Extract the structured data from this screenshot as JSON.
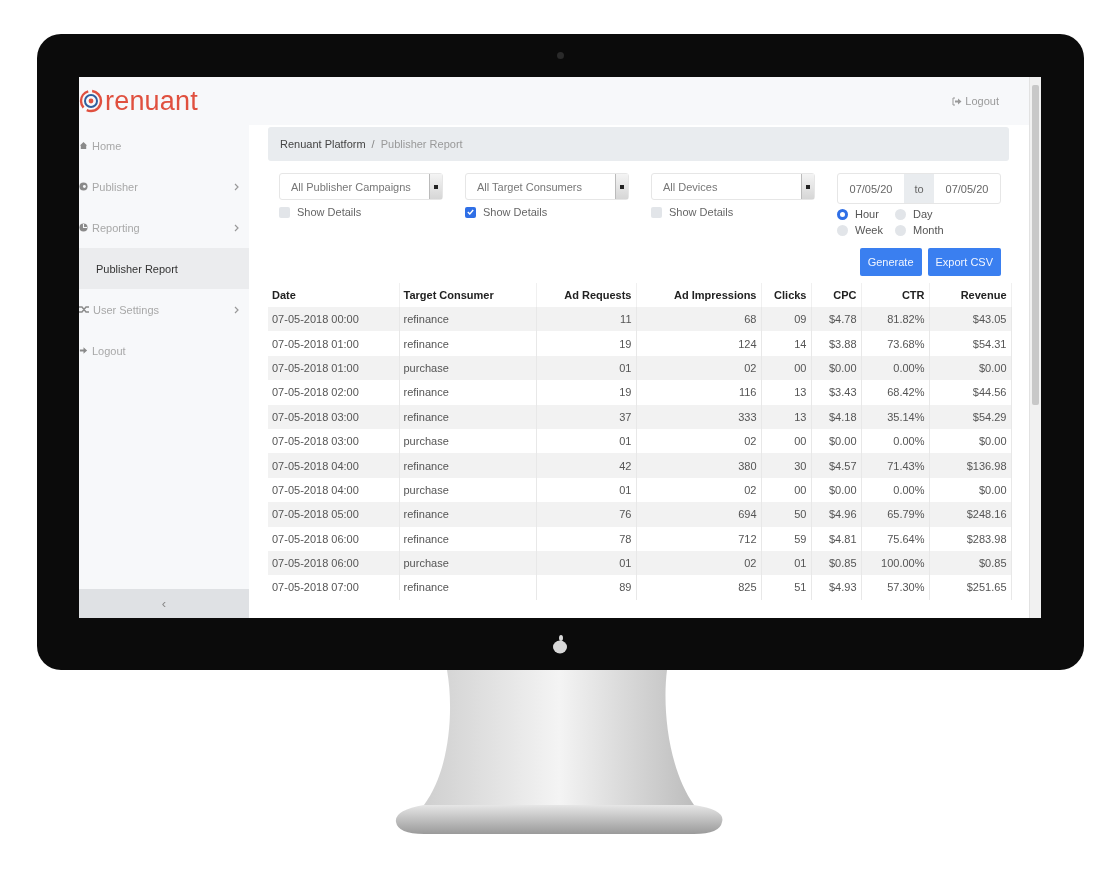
{
  "logo": {
    "text": "renuant"
  },
  "header": {
    "logout": "Logout"
  },
  "sidebar": {
    "items": [
      {
        "label": "Home",
        "kind": "home",
        "submenu": false,
        "selected": false
      },
      {
        "label": "Publisher",
        "kind": "publisher",
        "submenu": true,
        "selected": false
      },
      {
        "label": "Reporting",
        "kind": "reporting",
        "submenu": true,
        "selected": false
      },
      {
        "label": "Publisher Report",
        "kind": "sub",
        "submenu": false,
        "selected": true
      },
      {
        "label": "User Settings",
        "kind": "settings",
        "submenu": true,
        "selected": false
      },
      {
        "label": "Logout",
        "kind": "logout",
        "submenu": false,
        "selected": false
      }
    ],
    "collapse": "‹"
  },
  "breadcrumb": [
    {
      "label": "Renuant Platform",
      "current": false
    },
    {
      "label": "Publisher Report",
      "current": true
    }
  ],
  "breadcrumb_separator": "/",
  "filters": [
    {
      "value": "All Publisher Campaigns",
      "checkbox_label": "Show Details",
      "checked": false
    },
    {
      "value": "All Target Consumers",
      "checkbox_label": "Show Details",
      "checked": true
    },
    {
      "value": "All Devices",
      "checkbox_label": "Show Details",
      "checked": false
    }
  ],
  "date_range": {
    "from": "07/05/20",
    "separator": "to",
    "to": "07/05/20"
  },
  "granularity": [
    {
      "label": "Hour",
      "selected": true
    },
    {
      "label": "Day",
      "selected": false
    },
    {
      "label": "Week",
      "selected": false
    },
    {
      "label": "Month",
      "selected": false
    }
  ],
  "buttons": [
    "Generate",
    "Export CSV"
  ],
  "table": {
    "columns": [
      "Date",
      "Target Consumer",
      "Ad Requests",
      "Ad Impressions",
      "Clicks",
      "CPC",
      "CTR",
      "Revenue"
    ],
    "rows": [
      [
        "07-05-2018 00:00",
        "refinance",
        "11",
        "68",
        "09",
        "$4.78",
        "81.82%",
        "$43.05"
      ],
      [
        "07-05-2018 01:00",
        "refinance",
        "19",
        "124",
        "14",
        "$3.88",
        "73.68%",
        "$54.31"
      ],
      [
        "07-05-2018 01:00",
        "purchase",
        "01",
        "02",
        "00",
        "$0.00",
        "0.00%",
        "$0.00"
      ],
      [
        "07-05-2018 02:00",
        "refinance",
        "19",
        "116",
        "13",
        "$3.43",
        "68.42%",
        "$44.56"
      ],
      [
        "07-05-2018 03:00",
        "refinance",
        "37",
        "333",
        "13",
        "$4.18",
        "35.14%",
        "$54.29"
      ],
      [
        "07-05-2018 03:00",
        "purchase",
        "01",
        "02",
        "00",
        "$0.00",
        "0.00%",
        "$0.00"
      ],
      [
        "07-05-2018 04:00",
        "refinance",
        "42",
        "380",
        "30",
        "$4.57",
        "71.43%",
        "$136.98"
      ],
      [
        "07-05-2018 04:00",
        "purchase",
        "01",
        "02",
        "00",
        "$0.00",
        "0.00%",
        "$0.00"
      ],
      [
        "07-05-2018 05:00",
        "refinance",
        "76",
        "694",
        "50",
        "$4.96",
        "65.79%",
        "$248.16"
      ],
      [
        "07-05-2018 06:00",
        "refinance",
        "78",
        "712",
        "59",
        "$4.81",
        "75.64%",
        "$283.98"
      ],
      [
        "07-05-2018 06:00",
        "purchase",
        "01",
        "02",
        "01",
        "$0.85",
        "100.00%",
        "$0.85"
      ],
      [
        "07-05-2018 07:00",
        "refinance",
        "89",
        "825",
        "51",
        "$4.93",
        "57.30%",
        "$251.65"
      ]
    ]
  }
}
